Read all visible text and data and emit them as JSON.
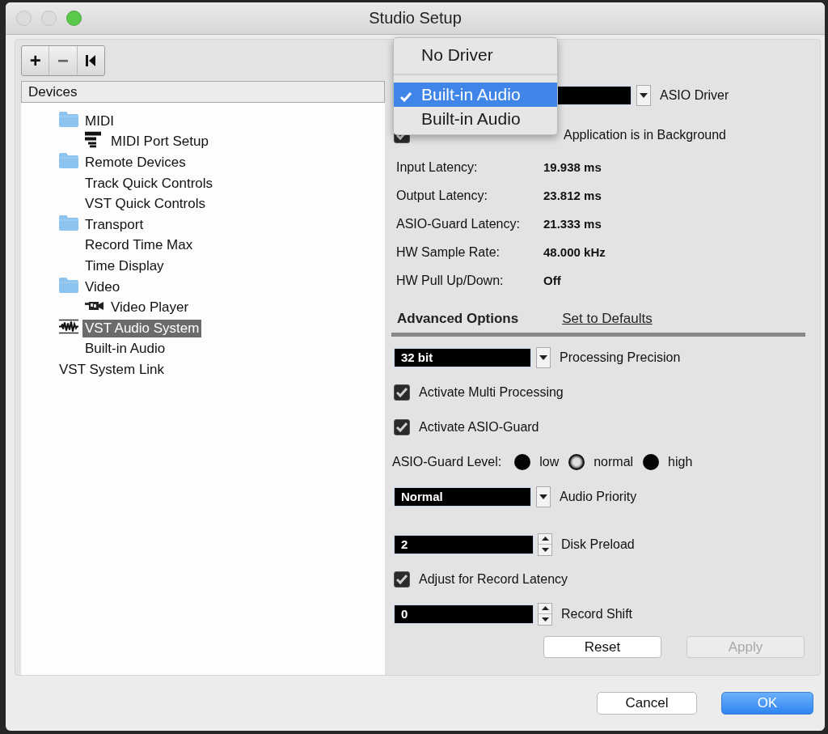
{
  "window": {
    "title": "Studio Setup"
  },
  "toolbar": {
    "buttons": [
      "+",
      "−"
    ]
  },
  "devices": {
    "header": "Devices",
    "items": [
      {
        "label": "MIDI",
        "kind": "folder",
        "selected": false,
        "children": [
          {
            "label": "MIDI Port Setup",
            "kind": "port_setup",
            "selected": false
          }
        ]
      },
      {
        "label": "Remote Devices",
        "kind": "folder",
        "selected": false,
        "children": [
          {
            "label": "Track Quick Controls",
            "selected": false
          },
          {
            "label": "VST Quick Controls",
            "selected": false
          }
        ]
      },
      {
        "label": "Transport",
        "kind": "folder",
        "selected": false,
        "children": [
          {
            "label": "Record Time Max",
            "selected": false
          },
          {
            "label": "Time Display",
            "selected": false
          }
        ]
      },
      {
        "label": "Video",
        "kind": "folder",
        "selected": false,
        "children": [
          {
            "label": "Video Player",
            "kind": "video",
            "selected": false
          }
        ]
      },
      {
        "label": "VST Audio System",
        "kind": "audio",
        "selected": true,
        "children": [
          {
            "label": "Built-in Audio",
            "selected": false
          }
        ]
      },
      {
        "label": "VST System Link",
        "selected": false
      }
    ]
  },
  "driver": {
    "label": "ASIO Driver",
    "menu": [
      {
        "label": "No Driver",
        "selected": false
      },
      {
        "label": "Built-in Audio",
        "selected": true
      },
      {
        "label": "Built-in Audio",
        "selected": false
      }
    ]
  },
  "background_option": {
    "label": "Application is in Background",
    "checked": true
  },
  "latencies": [
    {
      "label": "Input Latency:",
      "value": "19.938 ms"
    },
    {
      "label": "Output Latency:",
      "value": "23.812 ms"
    },
    {
      "label": "ASIO-Guard Latency:",
      "value": "21.333 ms"
    },
    {
      "label": "HW Sample Rate:",
      "value": "48.000 kHz"
    },
    {
      "label": "HW Pull Up/Down:",
      "value": "Off"
    }
  ],
  "advanced": {
    "title": "Advanced Options",
    "defaults_link": "Set to Defaults"
  },
  "settings": [
    {
      "kind": "dropdown",
      "label": "Processing Precision",
      "selection": "32 bit"
    },
    {
      "kind": "checkbox",
      "label": "Activate Multi Processing",
      "checked": true
    },
    {
      "kind": "checkbox",
      "label": "Activate ASIO-Guard",
      "checked": true
    },
    {
      "kind": "radio",
      "label": "ASIO-Guard Level:",
      "options": [
        {
          "label": "low",
          "selected": false
        },
        {
          "label": "normal",
          "selected": true
        },
        {
          "label": "high",
          "selected": false
        }
      ]
    },
    {
      "kind": "dropdown",
      "label": "Audio Priority",
      "selection": "Normal"
    },
    {
      "kind": "spinner",
      "label": "Disk Preload",
      "number": "2"
    },
    {
      "kind": "checkbox",
      "label": "Adjust for Record Latency",
      "checked": true
    },
    {
      "kind": "spinner",
      "label": "Record Shift",
      "number": "0"
    }
  ],
  "panel_buttons": [
    {
      "label": "Reset",
      "disabled": false
    },
    {
      "label": "Apply",
      "disabled": true
    }
  ],
  "dialog_buttons": [
    {
      "label": "Cancel",
      "default": false
    },
    {
      "label": "OK",
      "default": true
    }
  ]
}
